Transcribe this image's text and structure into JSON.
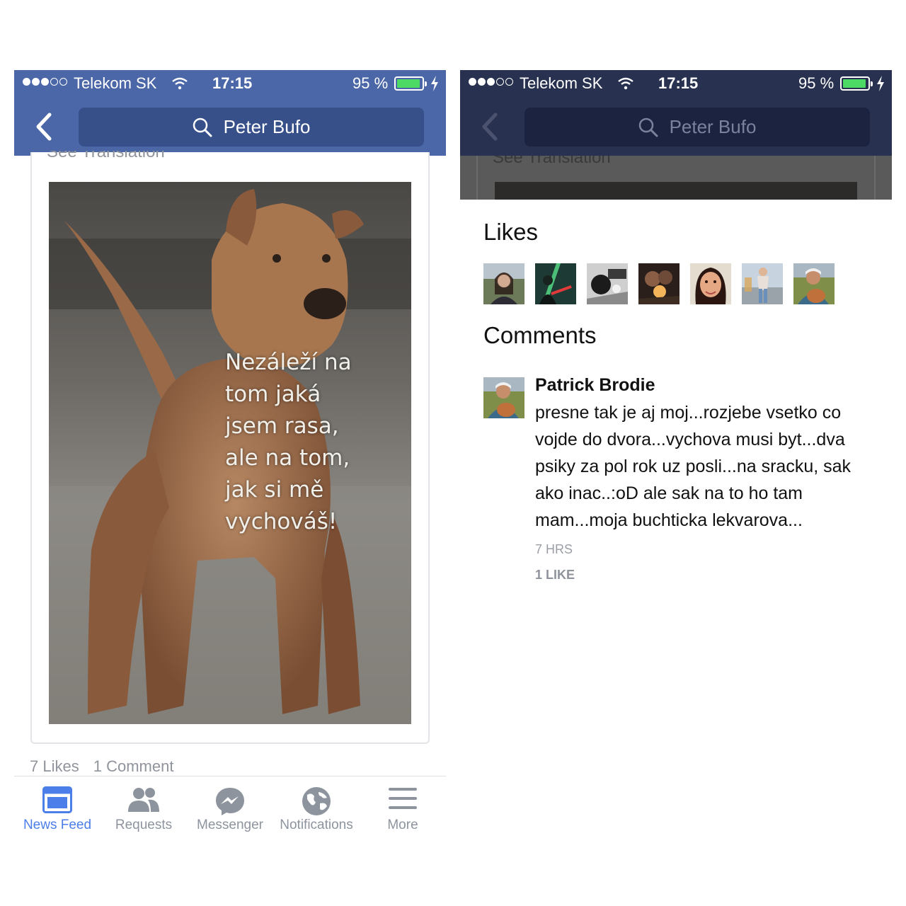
{
  "status_bar": {
    "carrier": "Telekom SK",
    "time": "17:15",
    "battery": "95 %",
    "signal_bars_filled": 3,
    "signal_bars_total": 5,
    "battery_level": 0.95
  },
  "search": {
    "query": "Peter Bufo"
  },
  "post": {
    "see_translation": "See Translation",
    "image_text": "Nezáleží na\ntom jaká\njsem rasa,\nale na tom,\njak si mě\nvychováš!",
    "likes_count": "7 Likes",
    "comment_count": "1 Comment"
  },
  "tabbar": {
    "tabs": [
      {
        "label": "News Feed",
        "icon": "news-feed-icon",
        "active": true
      },
      {
        "label": "Requests",
        "icon": "friend-requests-icon",
        "active": false
      },
      {
        "label": "Messenger",
        "icon": "messenger-icon",
        "active": false
      },
      {
        "label": "Notifications",
        "icon": "globe-icon",
        "active": false
      },
      {
        "label": "More",
        "icon": "hamburger-menu-icon",
        "active": false
      }
    ]
  },
  "likes_sheet": {
    "likes_title": "Likes",
    "comments_title": "Comments",
    "liker_avatar_count": 7
  },
  "comment": {
    "author": "Patrick Brodie",
    "text": "presne tak je aj moj...rozjebe vsetko co vojde do dvora...vychova musi byt...dva psiky za pol rok uz posli...na sracku, sak ako inac..:oD ale sak na to ho tam mam...moja buchticka lekvarova...",
    "time": "7 HRS",
    "likes": "1 LIKE"
  },
  "colors": {
    "nav_blue": "#4b67a8",
    "nav_dimmed": "#283250",
    "active_tab": "#4b7ee8",
    "inactive_tab": "#8d949e",
    "battery_green": "#4cd964"
  }
}
